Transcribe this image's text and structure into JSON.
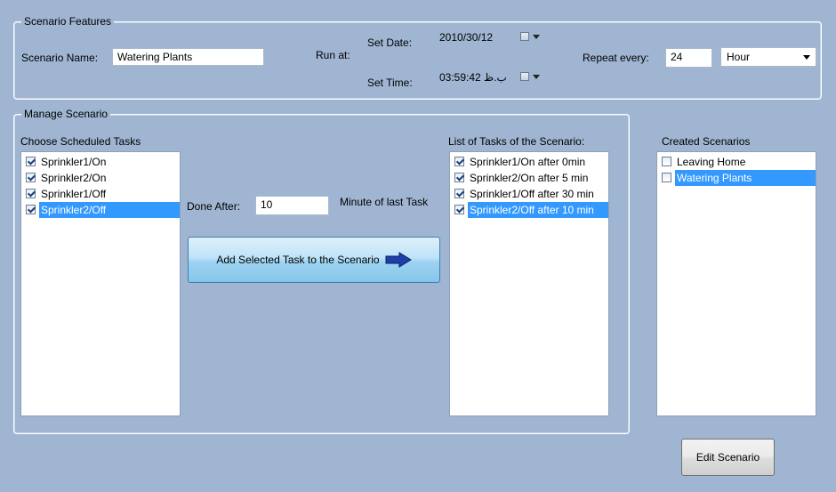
{
  "features": {
    "legend": "Scenario Features",
    "name_label": "Scenario Name:",
    "name_value": "Watering Plants",
    "run_at_label": "Run at:",
    "set_date_label": "Set Date:",
    "date_value": "2010/30/12",
    "set_time_label": "Set Time:",
    "time_value": "03:59:42 ب.ظ",
    "repeat_label": "Repeat every:",
    "repeat_value": "24",
    "unit_value": "Hour"
  },
  "manage": {
    "legend": "Manage Scenario",
    "choose_label": "Choose Scheduled Tasks",
    "choose_items": [
      {
        "label": "Sprinkler1/On",
        "checked": true,
        "selected": false
      },
      {
        "label": "Sprinkler2/On",
        "checked": true,
        "selected": false
      },
      {
        "label": "Sprinkler1/Off",
        "checked": true,
        "selected": false
      },
      {
        "label": "Sprinkler2/Off",
        "checked": true,
        "selected": true
      }
    ],
    "done_after_label": "Done After:",
    "done_after_value": "10",
    "minute_label": "Minute of last Task",
    "add_button_label": "Add  Selected Task to the Scenario",
    "list_label": "List of Tasks of the Scenario:",
    "list_items": [
      {
        "label": "Sprinkler1/On after 0min",
        "checked": true,
        "selected": false
      },
      {
        "label": "Sprinkler2/On after 5 min",
        "checked": true,
        "selected": false
      },
      {
        "label": "Sprinkler1/Off after 30 min",
        "checked": true,
        "selected": false
      },
      {
        "label": "Sprinkler2/Off after 10 min",
        "checked": true,
        "selected": true
      }
    ]
  },
  "created": {
    "label": "Created Scenarios",
    "items": [
      {
        "label": "Leaving Home",
        "checked": false,
        "selected": false
      },
      {
        "label": "Watering Plants",
        "checked": false,
        "selected": true
      }
    ]
  },
  "edit_button_label": "Edit Scenario",
  "colors": {
    "background": "#9fb5d2",
    "selection": "#3399ff",
    "arrow": "#1f3fa8"
  }
}
